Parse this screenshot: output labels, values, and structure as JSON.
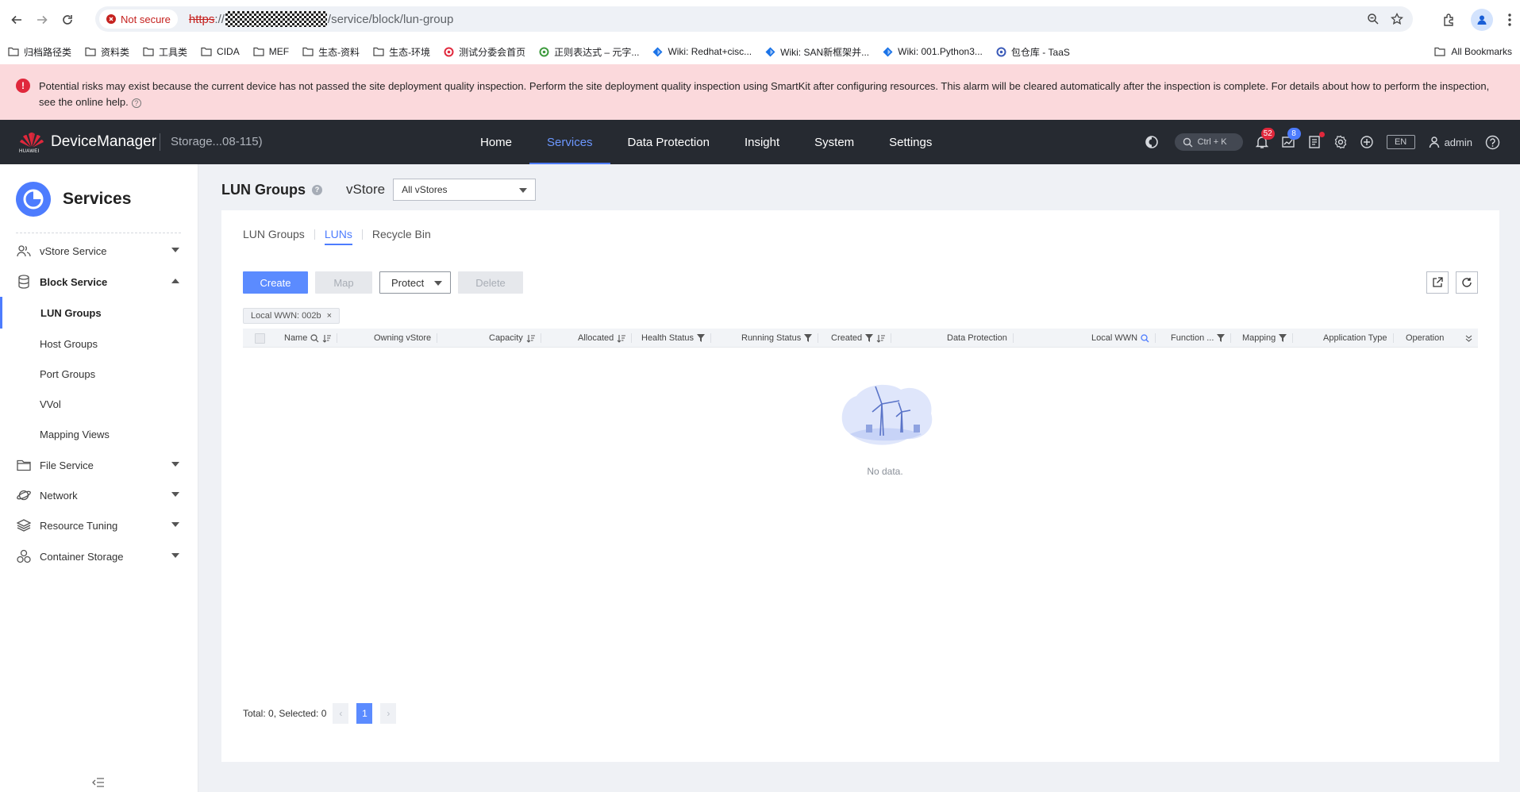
{
  "browser": {
    "security_label": "Not secure",
    "url_scheme": "https",
    "url_sep": "://",
    "url_path": "/service/block/lun-group",
    "bookmarks": [
      {
        "label": "归档路径类",
        "icon": "folder-icon"
      },
      {
        "label": "资料类",
        "icon": "folder-icon"
      },
      {
        "label": "工具类",
        "icon": "folder-icon"
      },
      {
        "label": "CIDA",
        "icon": "folder-icon"
      },
      {
        "label": "MEF",
        "icon": "folder-icon"
      },
      {
        "label": "生态-资料",
        "icon": "folder-icon"
      },
      {
        "label": "生态-环境",
        "icon": "folder-icon"
      },
      {
        "label": "测试分委会首页",
        "icon": "site-icon",
        "color": "#e0283c"
      },
      {
        "label": "正则表达式 – 元字...",
        "icon": "site-icon",
        "color": "#3c9a3c"
      },
      {
        "label": "Wiki: Redhat+cisc...",
        "icon": "wiki-icon",
        "color": "#1a73e8"
      },
      {
        "label": "Wiki: SAN新框架并...",
        "icon": "wiki-icon",
        "color": "#1a73e8"
      },
      {
        "label": "Wiki: 001.Python3...",
        "icon": "wiki-icon",
        "color": "#1a73e8"
      },
      {
        "label": "包仓库 - TaaS",
        "icon": "site-icon",
        "color": "#3a5ab8"
      }
    ],
    "all_bookmarks": "All Bookmarks"
  },
  "alert": {
    "text": "Potential risks may exist because the current device has not passed the site deployment quality inspection. Perform the site deployment quality inspection using SmartKit after configuring resources. This alarm will be cleared automatically after the inspection is complete. For details about how to perform the inspection, see the online help."
  },
  "header": {
    "brand": "DeviceManager",
    "logo_text": "HUAWEI",
    "device": "Storage...08-115)",
    "nav": [
      {
        "label": "Home",
        "active": false
      },
      {
        "label": "Services",
        "active": true
      },
      {
        "label": "Data Protection",
        "active": false
      },
      {
        "label": "Insight",
        "active": false
      },
      {
        "label": "System",
        "active": false
      },
      {
        "label": "Settings",
        "active": false
      }
    ],
    "search_hint": "Ctrl + K",
    "alarm_count": "52",
    "task_count": "8",
    "lang": "EN",
    "user": "admin"
  },
  "sidebar": {
    "title": "Services",
    "items": [
      {
        "label": "vStore Service",
        "icon": "users-icon",
        "expandable": true
      },
      {
        "label": "Block Service",
        "icon": "database-icon",
        "expandable": true,
        "expanded": true
      },
      {
        "label": "LUN Groups",
        "active": true
      },
      {
        "label": "Host Groups"
      },
      {
        "label": "Port Groups"
      },
      {
        "label": "VVol"
      },
      {
        "label": "Mapping Views"
      },
      {
        "label": "File Service",
        "icon": "folder-icon",
        "expandable": true
      },
      {
        "label": "Network",
        "icon": "network-icon",
        "expandable": true
      },
      {
        "label": "Resource Tuning",
        "icon": "layers-icon",
        "expandable": true
      },
      {
        "label": "Container Storage",
        "icon": "container-icon",
        "expandable": true
      }
    ]
  },
  "page": {
    "title": "LUN Groups",
    "vstore_label": "vStore",
    "vstore_value": "All vStores",
    "tabs": [
      {
        "label": "LUN Groups",
        "active": false
      },
      {
        "label": "LUNs",
        "active": true
      },
      {
        "label": "Recycle Bin",
        "active": false
      }
    ],
    "buttons": {
      "create": "Create",
      "map": "Map",
      "protect": "Protect",
      "delete": "Delete"
    },
    "filter_tag": "Local WWN: 002b",
    "columns": [
      {
        "label": "Name",
        "icons": [
          "search",
          "sort"
        ]
      },
      {
        "label": "Owning vStore",
        "icons": []
      },
      {
        "label": "Capacity",
        "icons": [
          "sort"
        ]
      },
      {
        "label": "Allocated",
        "icons": [
          "sort"
        ]
      },
      {
        "label": "Health Status",
        "icons": [
          "filter"
        ]
      },
      {
        "label": "Running Status",
        "icons": [
          "filter"
        ]
      },
      {
        "label": "Created",
        "icons": [
          "filter",
          "sort"
        ]
      },
      {
        "label": "Data Protection",
        "icons": []
      },
      {
        "label": "Local WWN",
        "icons": [
          "search-active"
        ]
      },
      {
        "label": "Function ...",
        "icons": [
          "filter"
        ]
      },
      {
        "label": "Mapping",
        "icons": [
          "filter"
        ]
      },
      {
        "label": "Application Type",
        "icons": []
      },
      {
        "label": "Operation",
        "icons": []
      }
    ],
    "empty_text": "No data.",
    "pager": {
      "summary": "Total: 0, Selected: 0",
      "current": "1"
    }
  }
}
